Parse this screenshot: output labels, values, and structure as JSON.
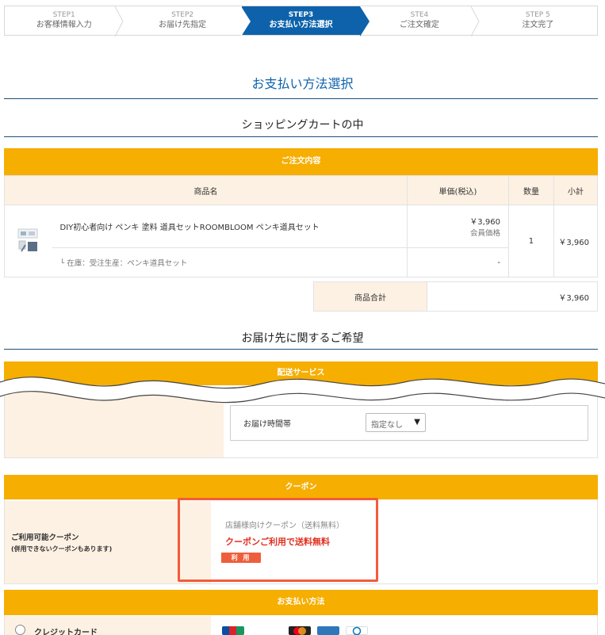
{
  "steps": [
    {
      "n": "STEP1",
      "t": "お客様情報入力"
    },
    {
      "n": "STEP2",
      "t": "お届け先指定"
    },
    {
      "n": "STEP3",
      "t": "お支払い方法選択"
    },
    {
      "n": "STE4",
      "t": "ご注文確定"
    },
    {
      "n": "STEP 5",
      "t": "注文完了"
    }
  ],
  "page_title": "お支払い方法選択",
  "cart_title": "ショッピングカートの中",
  "order": {
    "header": "ご注文内容",
    "columns": [
      "商品名",
      "単価(税込)",
      "数量",
      "小計"
    ],
    "item": {
      "name": "DIY初心者向け ペンキ 塗料 道具セットROOMBLOOM ペンキ道具セット",
      "price": "￥3,960",
      "price_note": "会員価格",
      "qty": "1",
      "subtotal": "￥3,960",
      "stock": "└ 在庫：受注生産：ペンキ道具セット",
      "stock_price": "-"
    },
    "total_label": "商品合計",
    "total_value": "￥3,960"
  },
  "delivery": {
    "title": "お届け先に関するご希望",
    "header": "配送サービス",
    "time_label": "お届け時間帯",
    "time_value": "指定なし",
    "time_arrow": "▼"
  },
  "coupon": {
    "header": "クーポン",
    "label": "ご利用可能クーポン",
    "sub": "(併用できないクーポンもあります)",
    "name": "店舗様向けクーポン（送料無料）",
    "desc": "クーポンご利用で送料無料",
    "button": "利 用"
  },
  "payment": {
    "header": "お支払い方法",
    "option": "クレジットカード"
  },
  "colors": {
    "accent": "#0d62ab",
    "header_bar": "#f6ae00",
    "label_bg": "#fdf1e3",
    "highlight": "#f35b3a",
    "coupon_red": "#e03020"
  }
}
